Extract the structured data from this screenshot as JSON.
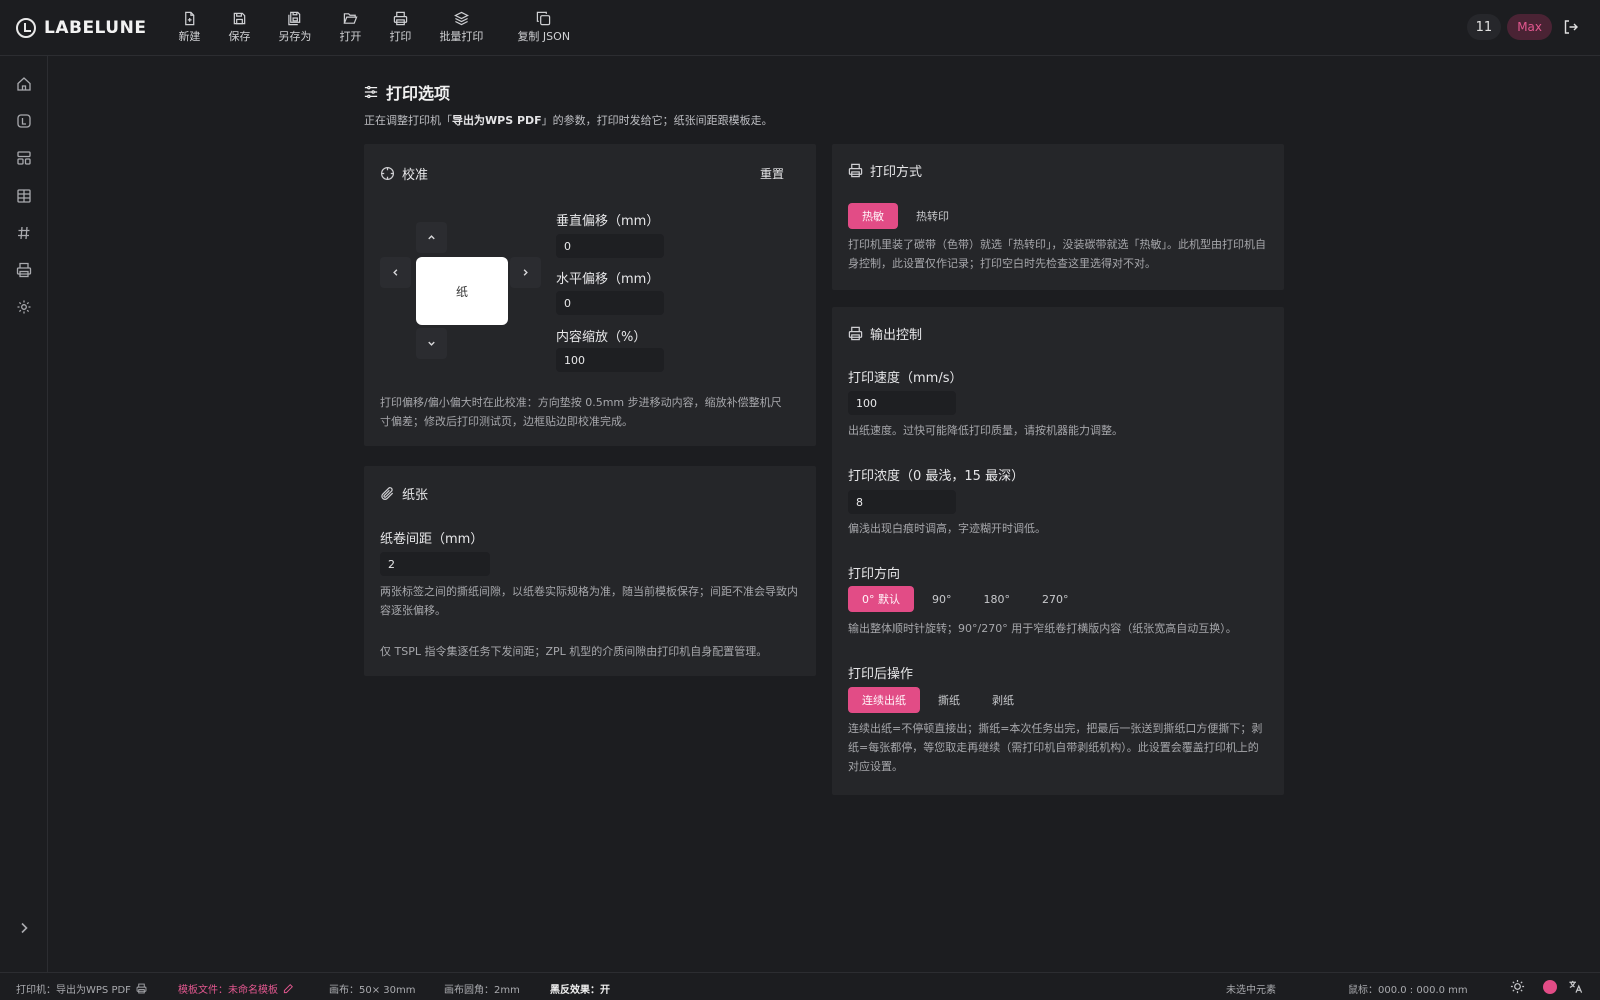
{
  "app": {
    "name": "LABELUNE"
  },
  "toolbar": {
    "new": "新建",
    "save": "保存",
    "save_as": "另存为",
    "open": "打开",
    "print": "打印",
    "batch_print": "批量打印",
    "copy_json": "复制 JSON"
  },
  "user": {
    "count": "11",
    "name": "Max"
  },
  "page": {
    "title": "打印选项",
    "subtitle_prefix": "正在调整打印机「",
    "printer_name": "导出为WPS PDF",
    "subtitle_suffix": "」的参数，打印时发给它；纸张间距跟模板走。"
  },
  "calibration": {
    "title": "校准",
    "reset": "重置",
    "paper_label": "纸",
    "vertical_label": "垂直偏移（mm）",
    "vertical_value": "0",
    "horizontal_label": "水平偏移（mm）",
    "horizontal_value": "0",
    "scale_label": "内容缩放（%）",
    "scale_value": "100",
    "hint": "打印偏移/偏小偏大时在此校准：方向垫按 0.5mm 步进移动内容，缩放补偿整机尺寸偏差；修改后打印测试页，边框贴边即校准完成。"
  },
  "paper": {
    "title": "纸张",
    "gap_label": "纸卷间距（mm）",
    "gap_value": "2",
    "hint1": "两张标签之间的撕纸间隙，以纸卷实际规格为准，随当前模板保存；间距不准会导致内容逐张偏移。",
    "hint2": "仅 TSPL 指令集逐任务下发间距；ZPL 机型的介质间隙由打印机自身配置管理。"
  },
  "print_method": {
    "title": "打印方式",
    "options": [
      "热敏",
      "热转印"
    ],
    "selected": "热敏",
    "hint": "打印机里装了碳带（色带）就选「热转印」，没装碳带就选「热敏」。此机型由打印机自身控制，此设置仅作记录；打印空白时先检查这里选得对不对。"
  },
  "output": {
    "title": "输出控制",
    "speed_label": "打印速度（mm/s）",
    "speed_value": "100",
    "speed_hint": "出纸速度。过快可能降低打印质量，请按机器能力调整。",
    "density_label": "打印浓度（0 最浅，15 最深）",
    "density_value": "8",
    "density_hint": "偏浅出现白痕时调高，字迹糊开时调低。",
    "direction_label": "打印方向",
    "direction_options": [
      "0° 默认",
      "90°",
      "180°",
      "270°"
    ],
    "direction_hint": "输出整体顺时针旋转；90°/270° 用于窄纸卷打横版内容（纸张宽高自动互换）。",
    "after_label": "打印后操作",
    "after_options": [
      "连续出纸",
      "撕纸",
      "剥纸"
    ],
    "after_hint": "连续出纸=不停顿直接出；撕纸=本次任务出完，把最后一张送到撕纸口方便撕下；剥纸=每张都停，等您取走再继续（需打印机自带剥纸机构）。此设置会覆盖打印机上的对应设置。"
  },
  "status": {
    "printer": "打印机：导出为WPS PDF",
    "template": "模板文件：未命名模板",
    "canvas": "画布：50× 30mm",
    "corner": "画布圆角：2mm",
    "invert": "黑反效果：开",
    "selection": "未选中元素",
    "cursor": "鼠标：000.0 : 000.0 mm"
  },
  "colors": {
    "accent": "#e24c86",
    "background": "#1c1d20",
    "card": "#252629"
  }
}
